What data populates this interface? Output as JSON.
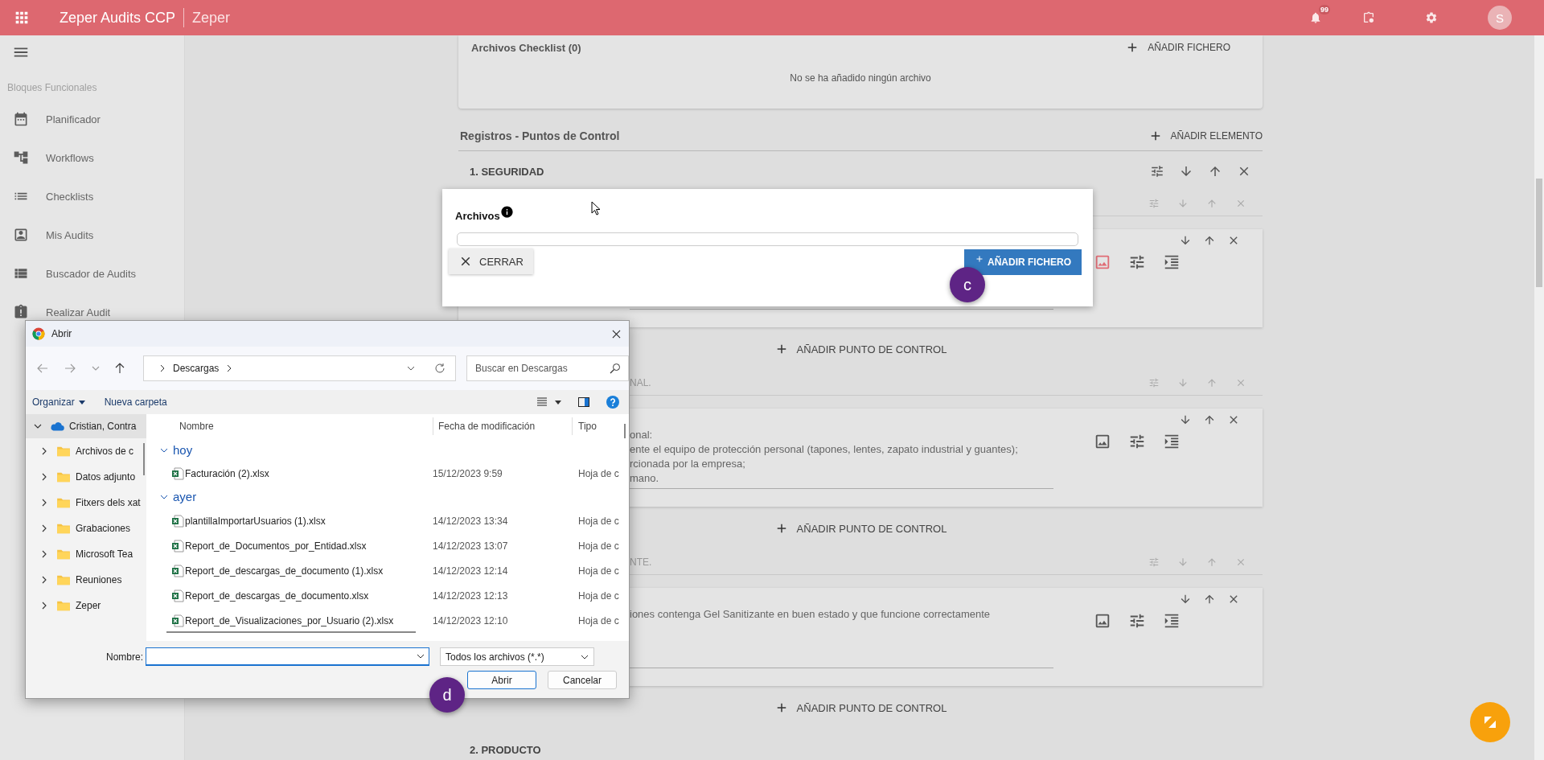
{
  "app_bar": {
    "product": "Zeper Audits",
    "edition": "CCP",
    "company": "Zeper",
    "notifications_badge": "99",
    "avatar_initial": "S"
  },
  "sidebar": {
    "section_title": "Bloques Funcionales",
    "items": [
      {
        "label": "Planificador"
      },
      {
        "label": "Workflows"
      },
      {
        "label": "Checklists"
      },
      {
        "label": "Mis Audits"
      },
      {
        "label": "Buscador de Audits"
      },
      {
        "label": "Realizar Audit"
      }
    ]
  },
  "checklist_files": {
    "title": "Archivos Checklist (0)",
    "add_button": "AÑADIR FICHERO",
    "empty_message": "No se ha añadido ningún archivo"
  },
  "control_points": {
    "title": "Registros - Puntos de Control",
    "add_button": "AÑADIR ELEMENTO",
    "sections": [
      {
        "title": "1. SEGURIDAD",
        "items": [
          {
            "image_attached": true,
            "add_point_button": "AÑADIR PUNTO DE CONTROL"
          },
          {
            "heading_fragment": "NAL.",
            "text_lines": [
              "onal:",
              "ente el equipo de protección personal (tapones, lentes, zapato industrial y guantes);",
              "rcionada por la empresa;",
              "mano."
            ],
            "image_attached": false,
            "add_point_button": "AÑADIR PUNTO DE CONTROL"
          },
          {
            "heading_fragment": "NTE.",
            "text_lines": [
              "iones contenga Gel Sanitizante en buen estado y que funcione correctamente"
            ],
            "image_attached": false,
            "add_point_button": "AÑADIR PUNTO DE CONTROL"
          }
        ]
      },
      {
        "title": "2. PRODUCTO"
      }
    ]
  },
  "files_popup": {
    "title": "Archivos",
    "close_button": "CERRAR",
    "add_button": "AÑADIR FICHERO"
  },
  "open_dialog": {
    "title": "Abrir",
    "path": "Descargas",
    "search_placeholder": "Buscar en Descargas",
    "organize_button": "Organizar",
    "new_folder_button": "Nueva carpeta",
    "tree": [
      {
        "label": "Cristian, Contra",
        "expanded": true,
        "selected": true,
        "children": [
          {
            "label": "Archivos de c",
            "expanded": false,
            "selected": false
          },
          {
            "label": "Datos adjunto",
            "expanded": false,
            "selected": false
          },
          {
            "label": "Fitxers dels xat",
            "expanded": false,
            "selected": false
          },
          {
            "label": "Grabaciones",
            "expanded": false,
            "selected": false
          },
          {
            "label": "Microsoft Tea",
            "expanded": false,
            "selected": false
          },
          {
            "label": "Reuniones",
            "expanded": false,
            "selected": false
          },
          {
            "label": "Zeper",
            "expanded": false,
            "selected": false
          }
        ]
      }
    ],
    "columns": [
      "Nombre",
      "Fecha de modificación",
      "Tipo"
    ],
    "groups": [
      {
        "label": "hoy",
        "expanded": true,
        "files": [
          {
            "name": "Facturación (2).xlsx",
            "modified": "15/12/2023 9:59",
            "type": "Hoja de c"
          }
        ]
      },
      {
        "label": "ayer",
        "expanded": true,
        "files": [
          {
            "name": "plantillaImportarUsuarios (1).xlsx",
            "modified": "14/12/2023 13:34",
            "type": "Hoja de c"
          },
          {
            "name": "Report_de_Documentos_por_Entidad.xlsx",
            "modified": "14/12/2023 13:07",
            "type": "Hoja de c"
          },
          {
            "name": "Report_de_descargas_de_documento (1).xlsx",
            "modified": "14/12/2023 12:14",
            "type": "Hoja de c"
          },
          {
            "name": "Report_de_descargas_de_documento.xlsx",
            "modified": "14/12/2023 12:13",
            "type": "Hoja de c"
          },
          {
            "name": "Report_de_Visualizaciones_por_Usuario (2).xlsx",
            "modified": "14/12/2023 12:10",
            "type": "Hoja de c"
          }
        ]
      }
    ],
    "filename_label": "Nombre:",
    "filter": "Todos los archivos (*.*)",
    "open_button": "Abrir",
    "cancel_button": "Cancelar"
  },
  "step_markers": [
    {
      "label": "c"
    },
    {
      "label": "d"
    }
  ]
}
